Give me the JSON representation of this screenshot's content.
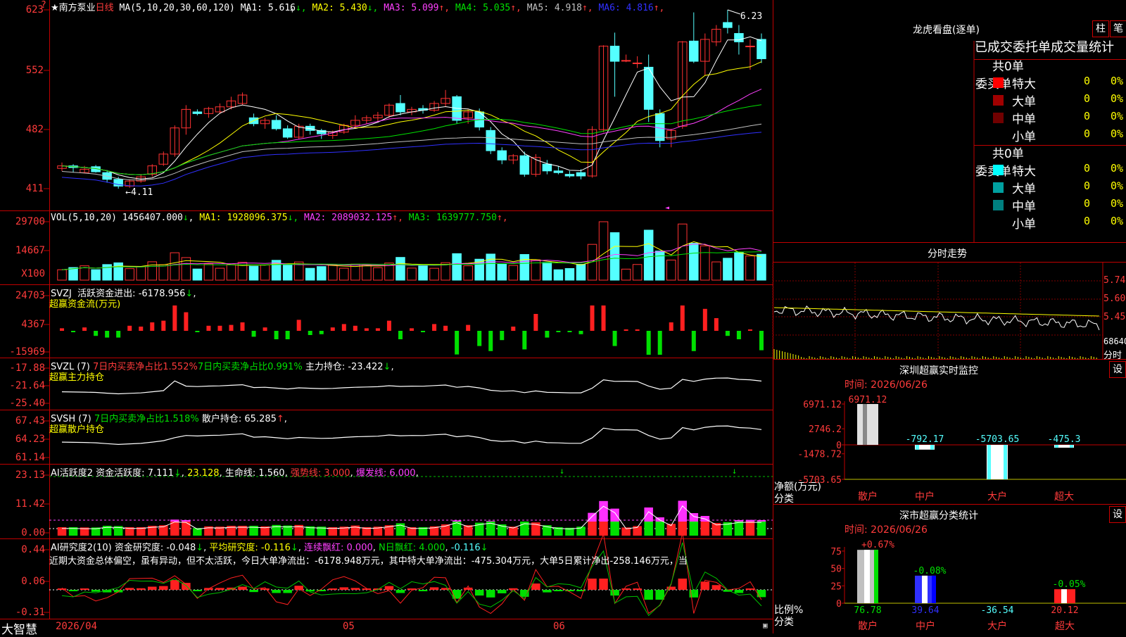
{
  "main": {
    "title": "★南方泵业",
    "period": "日线",
    "ma_label": "MA(5,10,20,30,60,120)",
    "ma_values": [
      {
        "label": "MA1:",
        "value": "5.616",
        "arrow": "↓",
        "color": "#ffffff"
      },
      {
        "label": "MA2:",
        "value": "5.430",
        "arrow": "↓",
        "color": "#ffff00"
      },
      {
        "label": "MA3:",
        "value": "5.099",
        "arrow": "↑",
        "color": "#ff40ff"
      },
      {
        "label": "MA4:",
        "value": "5.035",
        "arrow": "↑",
        "color": "#00e000"
      },
      {
        "label": "MA5:",
        "value": "4.918",
        "arrow": "↑",
        "color": "#c0c0c0"
      },
      {
        "label": "MA6:",
        "value": "4.816",
        "arrow": "↑",
        "color": "#3030ff"
      }
    ],
    "y_ticks": [
      "623",
      "552",
      "482",
      "411"
    ],
    "high_label": "6.23",
    "low_label": "4.11",
    "ohlc": [
      [
        4.35,
        4.42,
        4.32,
        4.38
      ],
      [
        4.38,
        4.4,
        4.3,
        4.36
      ],
      [
        4.3,
        4.38,
        4.29,
        4.34
      ],
      [
        4.37,
        4.39,
        4.3,
        4.31
      ],
      [
        4.3,
        4.33,
        4.18,
        4.22
      ],
      [
        4.22,
        4.25,
        4.11,
        4.14
      ],
      [
        4.14,
        4.22,
        4.12,
        4.2
      ],
      [
        4.2,
        4.28,
        4.18,
        4.25
      ],
      [
        4.28,
        4.4,
        4.25,
        4.38
      ],
      [
        4.4,
        4.55,
        4.38,
        4.52
      ],
      [
        4.52,
        4.86,
        4.49,
        4.83
      ],
      [
        4.83,
        5.1,
        4.75,
        5.05
      ],
      [
        5.02,
        5.05,
        4.98,
        5.0
      ],
      [
        5.0,
        5.08,
        4.95,
        5.06
      ],
      [
        5.02,
        5.12,
        5.0,
        5.08
      ],
      [
        5.08,
        5.2,
        5.05,
        5.15
      ],
      [
        5.12,
        5.25,
        5.1,
        5.22
      ],
      [
        4.95,
        5.0,
        4.85,
        4.88
      ],
      [
        4.88,
        4.95,
        4.82,
        4.92
      ],
      [
        4.92,
        4.98,
        4.8,
        4.82
      ],
      [
        4.82,
        4.86,
        4.7,
        4.72
      ],
      [
        4.72,
        4.88,
        4.7,
        4.85
      ],
      [
        4.85,
        4.88,
        4.75,
        4.8
      ],
      [
        4.8,
        4.82,
        4.7,
        4.76
      ],
      [
        4.74,
        4.8,
        4.7,
        4.78
      ],
      [
        4.78,
        4.88,
        4.76,
        4.86
      ],
      [
        4.86,
        4.98,
        4.82,
        4.92
      ],
      [
        4.92,
        4.98,
        4.88,
        4.95
      ],
      [
        4.95,
        5.02,
        4.9,
        4.98
      ],
      [
        4.98,
        5.12,
        4.95,
        5.1
      ],
      [
        5.12,
        5.22,
        4.98,
        5.02
      ],
      [
        5.02,
        5.08,
        4.98,
        5.05
      ],
      [
        5.06,
        5.1,
        5.0,
        5.04
      ],
      [
        5.04,
        5.15,
        5.02,
        5.12
      ],
      [
        5.12,
        5.28,
        5.08,
        5.18
      ],
      [
        5.2,
        5.22,
        4.88,
        4.92
      ],
      [
        4.95,
        5.05,
        4.88,
        5.02
      ],
      [
        5.02,
        5.06,
        4.8,
        4.84
      ],
      [
        4.8,
        4.84,
        4.52,
        4.56
      ],
      [
        4.56,
        4.6,
        4.4,
        4.45
      ],
      [
        4.45,
        4.52,
        4.4,
        4.5
      ],
      [
        4.5,
        4.55,
        4.25,
        4.28
      ],
      [
        4.28,
        4.52,
        4.25,
        4.48
      ],
      [
        4.4,
        4.45,
        4.28,
        4.32
      ],
      [
        4.32,
        4.38,
        4.28,
        4.3
      ],
      [
        4.28,
        4.32,
        4.24,
        4.26
      ],
      [
        4.3,
        4.34,
        4.22,
        4.26
      ],
      [
        4.26,
        4.85,
        4.24,
        4.81
      ],
      [
        4.81,
        5.81,
        4.78,
        5.8
      ],
      [
        5.8,
        5.96,
        5.2,
        5.62
      ],
      [
        5.63,
        5.7,
        5.61,
        5.63
      ],
      [
        5.6,
        5.68,
        5.54,
        5.6
      ],
      [
        5.55,
        5.7,
        4.9,
        5.05
      ],
      [
        5.0,
        5.05,
        4.6,
        4.68
      ],
      [
        4.7,
        4.82,
        4.6,
        4.8
      ],
      [
        4.85,
        5.86,
        4.82,
        5.85
      ],
      [
        5.86,
        6.2,
        5.6,
        5.62
      ],
      [
        5.62,
        5.95,
        5.45,
        5.88
      ],
      [
        5.85,
        6.05,
        5.8,
        6.0
      ],
      [
        6.08,
        6.23,
        5.95,
        6.02
      ],
      [
        5.95,
        6.05,
        5.7,
        5.85
      ],
      [
        5.8,
        5.88,
        5.52,
        5.8
      ],
      [
        5.88,
        5.95,
        5.6,
        5.65
      ]
    ]
  },
  "vol": {
    "label": "VOL(5,10,20)",
    "value": "1456407.000",
    "value_arrow": "↓",
    "ma": [
      {
        "label": "MA1:",
        "value": "1928096.375",
        "arrow": "↓",
        "color": "#ffff00"
      },
      {
        "label": "MA2:",
        "value": "2089032.125",
        "arrow": "↑",
        "color": "#ff40ff"
      },
      {
        "label": "MA3:",
        "value": "1639777.750",
        "arrow": "↑",
        "color": "#00e000"
      }
    ],
    "y_ticks": [
      "29700",
      "14667",
      "X100"
    ]
  },
  "svzj": {
    "label": "SVZJ",
    "item": "活跃资金进出:",
    "value": "-6178.956",
    "arrow": "↓",
    "subtitle": "超赢资金流(万元)",
    "y_ticks": [
      "24703",
      "4367",
      "-15969"
    ]
  },
  "svzl": {
    "label": "SVZL (7)",
    "buy_label": "7日内买卖净占比1.552%",
    "buy_label2": "7日内买卖净占比0.991%",
    "item": "主力持仓:",
    "value": "-23.422",
    "arrow": "↓",
    "subtitle": "超赢主力持仓",
    "y_ticks": [
      "-17.88",
      "-21.64",
      "-25.40"
    ]
  },
  "svsh": {
    "label": "SVSH (7)",
    "buy_label": "7日内买卖净占比1.518%",
    "item": "散户持仓:",
    "value": "65.285",
    "arrow": "↑",
    "subtitle": "超赢散户持仓",
    "y_ticks": [
      "67.43",
      "64.23",
      "61.14"
    ]
  },
  "ai1": {
    "label": "AI活跃度2",
    "item": "资金活跃度:",
    "value": "7.111",
    "arrow": "↓",
    "value2": "23.128",
    "life": "生命线: 1.560",
    "strong": "强势线: 3.000",
    "burst": "爆发线: 6.000",
    "y_ticks": [
      "23.13",
      "11.42",
      "0.00"
    ]
  },
  "ai2": {
    "label": "AI研究度2(10)",
    "item1": "资金研究度: -0.048",
    "arrow1": "↓",
    "item2": "平均研究度: -0.116",
    "arrow2": "↓",
    "item3": "连续飘红: 0.000",
    "item4": "N日飘红: 4.000",
    "item5": "-0.116",
    "arrow5": "↓",
    "commentary": "近期大资金总体偏空，虽有异动，但不太活跃，今日大单净流出：-6178.948万元，其中特大单净流出：-475.304万元，大单5日累计净出-258.146万元，当",
    "y_ticks": [
      "0.44",
      "0.06",
      "-0.31"
    ]
  },
  "bottom": {
    "brand": "大智慧",
    "date_labels": [
      "2026/04",
      "05",
      "06"
    ]
  },
  "right": {
    "lhb_title": "龙虎看盘(逐单)",
    "btn_zhu": "柱",
    "btn_bi": "笔",
    "header": "已成交委托单成交量统计",
    "buy": {
      "side": "委买单",
      "total": "共0单",
      "rows": [
        {
          "name": "特大",
          "count": "0",
          "pct": "0%",
          "color": "#ff0000"
        },
        {
          "name": "大单",
          "count": "0",
          "pct": "0%",
          "color": "#a00000"
        },
        {
          "name": "中单",
          "count": "0",
          "pct": "0%",
          "color": "#700000"
        },
        {
          "name": "小单",
          "count": "0",
          "pct": "0%",
          "color": ""
        }
      ]
    },
    "sell": {
      "side": "委卖单",
      "total": "共0单",
      "rows": [
        {
          "name": "特大",
          "count": "0",
          "pct": "0%",
          "color": "#00ffff"
        },
        {
          "name": "大单",
          "count": "0",
          "pct": "0%",
          "color": "#00a0a0"
        },
        {
          "name": "中单",
          "count": "0",
          "pct": "0%",
          "color": "#008080"
        },
        {
          "name": "小单",
          "count": "0",
          "pct": "0%",
          "color": ""
        }
      ]
    },
    "intraday": {
      "title": "分时走势",
      "y_ticks": [
        "5.74",
        "5.60",
        "5.45"
      ],
      "vol_tick": "68640",
      "vol_label": "分时"
    },
    "monitor": {
      "title": "深圳超赢实时监控",
      "btn": "设",
      "date": "时间: 2026/06/26",
      "y_ticks": [
        "6971.12",
        "2746.2",
        "0",
        "-1478.72",
        "-5703.65"
      ],
      "y_caption1": "净额(万元)",
      "y_caption2": "分类",
      "bars": [
        {
          "cat": "散户",
          "value": 6971.12,
          "label": "6971.12"
        },
        {
          "cat": "中户",
          "value": -792.17,
          "label": "-792.17"
        },
        {
          "cat": "大户",
          "value": -5703.65,
          "label": "-5703.65"
        },
        {
          "cat": "超大",
          "value": -475.3,
          "label": "-475.3"
        }
      ]
    },
    "classify": {
      "title": "深市超赢分类统计",
      "btn": "设",
      "date": "时间: 2026/06/26",
      "y_ticks": [
        "75",
        "50",
        "25",
        "0"
      ],
      "y_caption1": "比例%",
      "y_caption2": "分类",
      "bars": [
        {
          "cat": "散户",
          "value": 76.78,
          "label": "76.78",
          "pct": "+0.67%"
        },
        {
          "cat": "中户",
          "value": 39.64,
          "label": "39.64",
          "pct": "-0.08%"
        },
        {
          "cat": "大户",
          "value": -36.54,
          "label": "-36.54",
          "pct": ""
        },
        {
          "cat": "超大",
          "value": 20.12,
          "label": "20.12",
          "pct": "-0.05%"
        }
      ]
    }
  }
}
